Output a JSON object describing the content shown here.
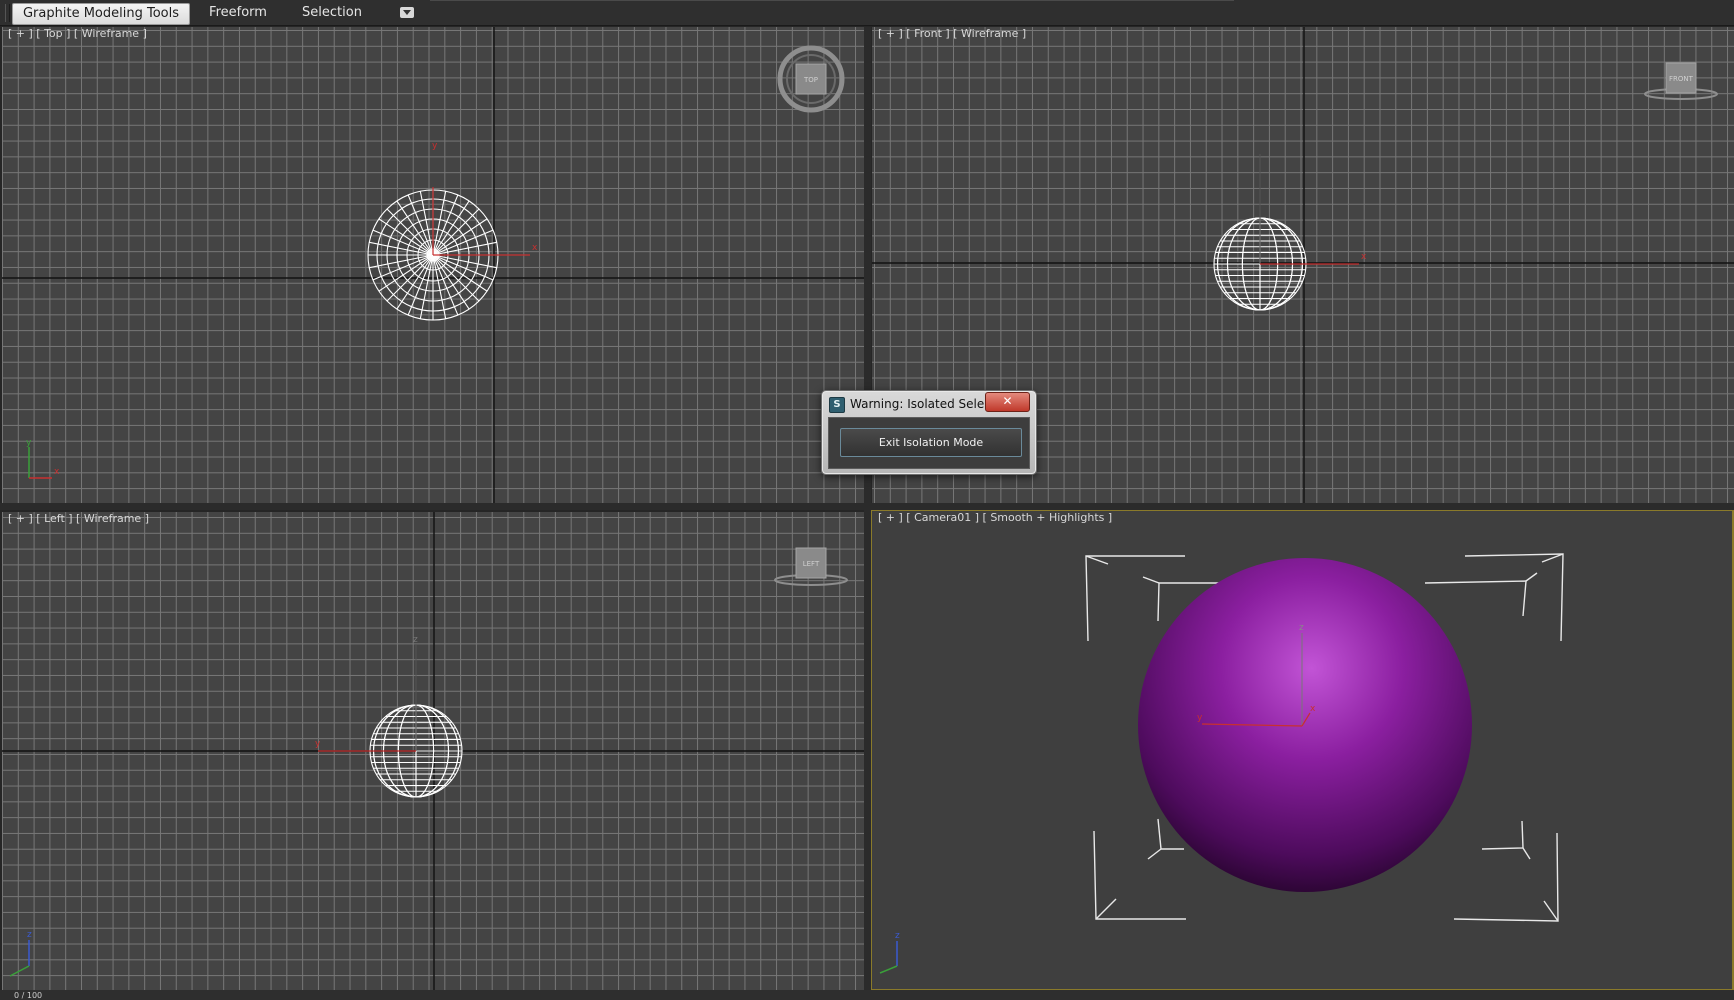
{
  "ribbon": {
    "tabs": [
      {
        "label": "Graphite Modeling Tools",
        "active": true
      },
      {
        "label": "Freeform",
        "active": false
      },
      {
        "label": "Selection",
        "active": false
      }
    ],
    "menu_icon": "dropdown-arrow-icon"
  },
  "viewports": {
    "top": {
      "label": "[ + ] [ Top ] [ Wireframe ]",
      "viewcube": "TOP"
    },
    "front": {
      "label": "[ + ] [ Front ] [ Wireframe ]",
      "viewcube": "FRONT"
    },
    "left": {
      "label": "[ + ] [ Left ] [ Wireframe ]",
      "viewcube": "LEFT"
    },
    "camera": {
      "label": "[ + ] [ Camera01 ] [ Smooth + Highlights ]",
      "active": true
    }
  },
  "axis_labels": {
    "x": "x",
    "y": "y",
    "z": "z"
  },
  "dialog": {
    "title": "Warning: Isolated Sele...",
    "close_glyph": "✕",
    "button_label": "Exit Isolation Mode",
    "app_icon": "max-app-icon"
  },
  "status": {
    "frame_counter": "0 / 100"
  },
  "colors": {
    "viewport_bg": "#444444",
    "grid": "#777777",
    "sphere": "#8b1fa0",
    "active_border": "#8a7a2a",
    "axis_x": "#c83030",
    "axis_y": "#3aa03a",
    "axis_z": "#3a5ad0"
  }
}
